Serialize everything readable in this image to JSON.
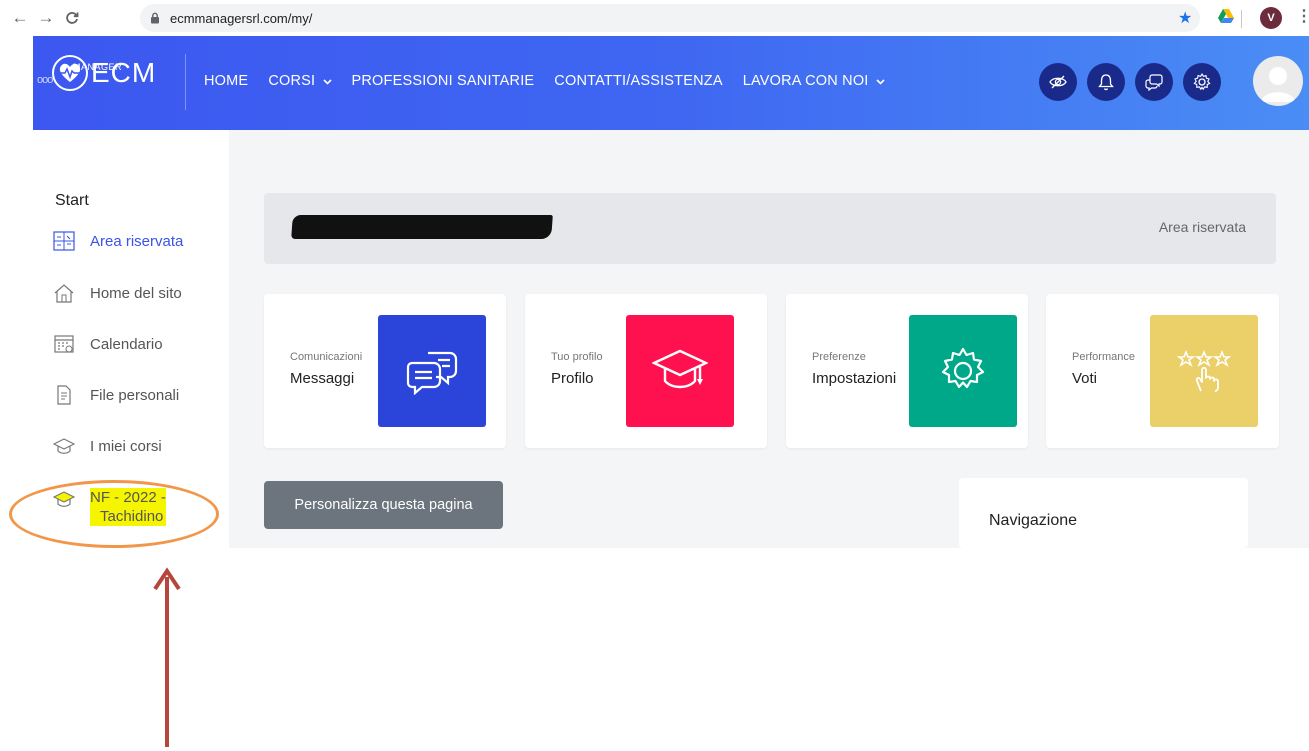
{
  "browser": {
    "back": "←",
    "forward": "→",
    "reload": "C",
    "url": "ecmmanagersrl.com/my/",
    "profile_initial": "V"
  },
  "navbar": {
    "logo_text": "ECM",
    "logo_sub": "MANAGER",
    "logo_dots": "ooo",
    "menu": [
      {
        "label": "HOME"
      },
      {
        "label": "CORSI",
        "has_dropdown": true
      },
      {
        "label": "PROFESSIONI SANITARIE"
      },
      {
        "label": "CONTATTI/ASSISTENZA"
      },
      {
        "label": "LAVORA CON NOI",
        "has_dropdown": true
      }
    ],
    "chevron": "⌄",
    "actions": [
      "eye-off-icon",
      "bell-icon",
      "chat-icon",
      "settings-icon"
    ]
  },
  "sidebar": {
    "title": "Start",
    "items": [
      {
        "label": "Area riservata",
        "icon": "dashboard-icon",
        "active": true
      },
      {
        "label": "Home del sito",
        "icon": "home-icon"
      },
      {
        "label": "Calendario",
        "icon": "calendar-icon"
      },
      {
        "label": "File personali",
        "icon": "file-icon"
      },
      {
        "label": "I miei corsi",
        "icon": "graduation-cap-icon"
      },
      {
        "label_line1": "NF - 2022 -",
        "label_line2": "Tachidino",
        "icon": "graduation-cap-icon",
        "highlighted": true
      }
    ]
  },
  "main": {
    "header_right": "Area riservata",
    "cards": [
      {
        "caption": "Comunicazioni",
        "title": "Messaggi",
        "icon": "chat-bubbles-icon",
        "color": "#2b45db"
      },
      {
        "caption": "Tuo profilo",
        "title": "Profilo",
        "icon": "graduation-cap-icon",
        "color": "#ff1150"
      },
      {
        "caption": "Preferenze",
        "title": "Impostazioni",
        "icon": "gear-icon",
        "color": "#00a88a"
      },
      {
        "caption": "Performance",
        "title": "Voti",
        "icon": "stars-hand-icon",
        "color": "#ebd06a"
      }
    ],
    "customize_button": "Personalizza questa pagina",
    "nav_block_title": "Navigazione"
  },
  "colors": {
    "navbar_start": "#3c57f0",
    "navbar_end": "#4a8df5",
    "active": "#3b53e8",
    "annotation_ellipse": "#f2974a",
    "annotation_arrow": "#b5463c",
    "highlight": "#f5f500"
  }
}
